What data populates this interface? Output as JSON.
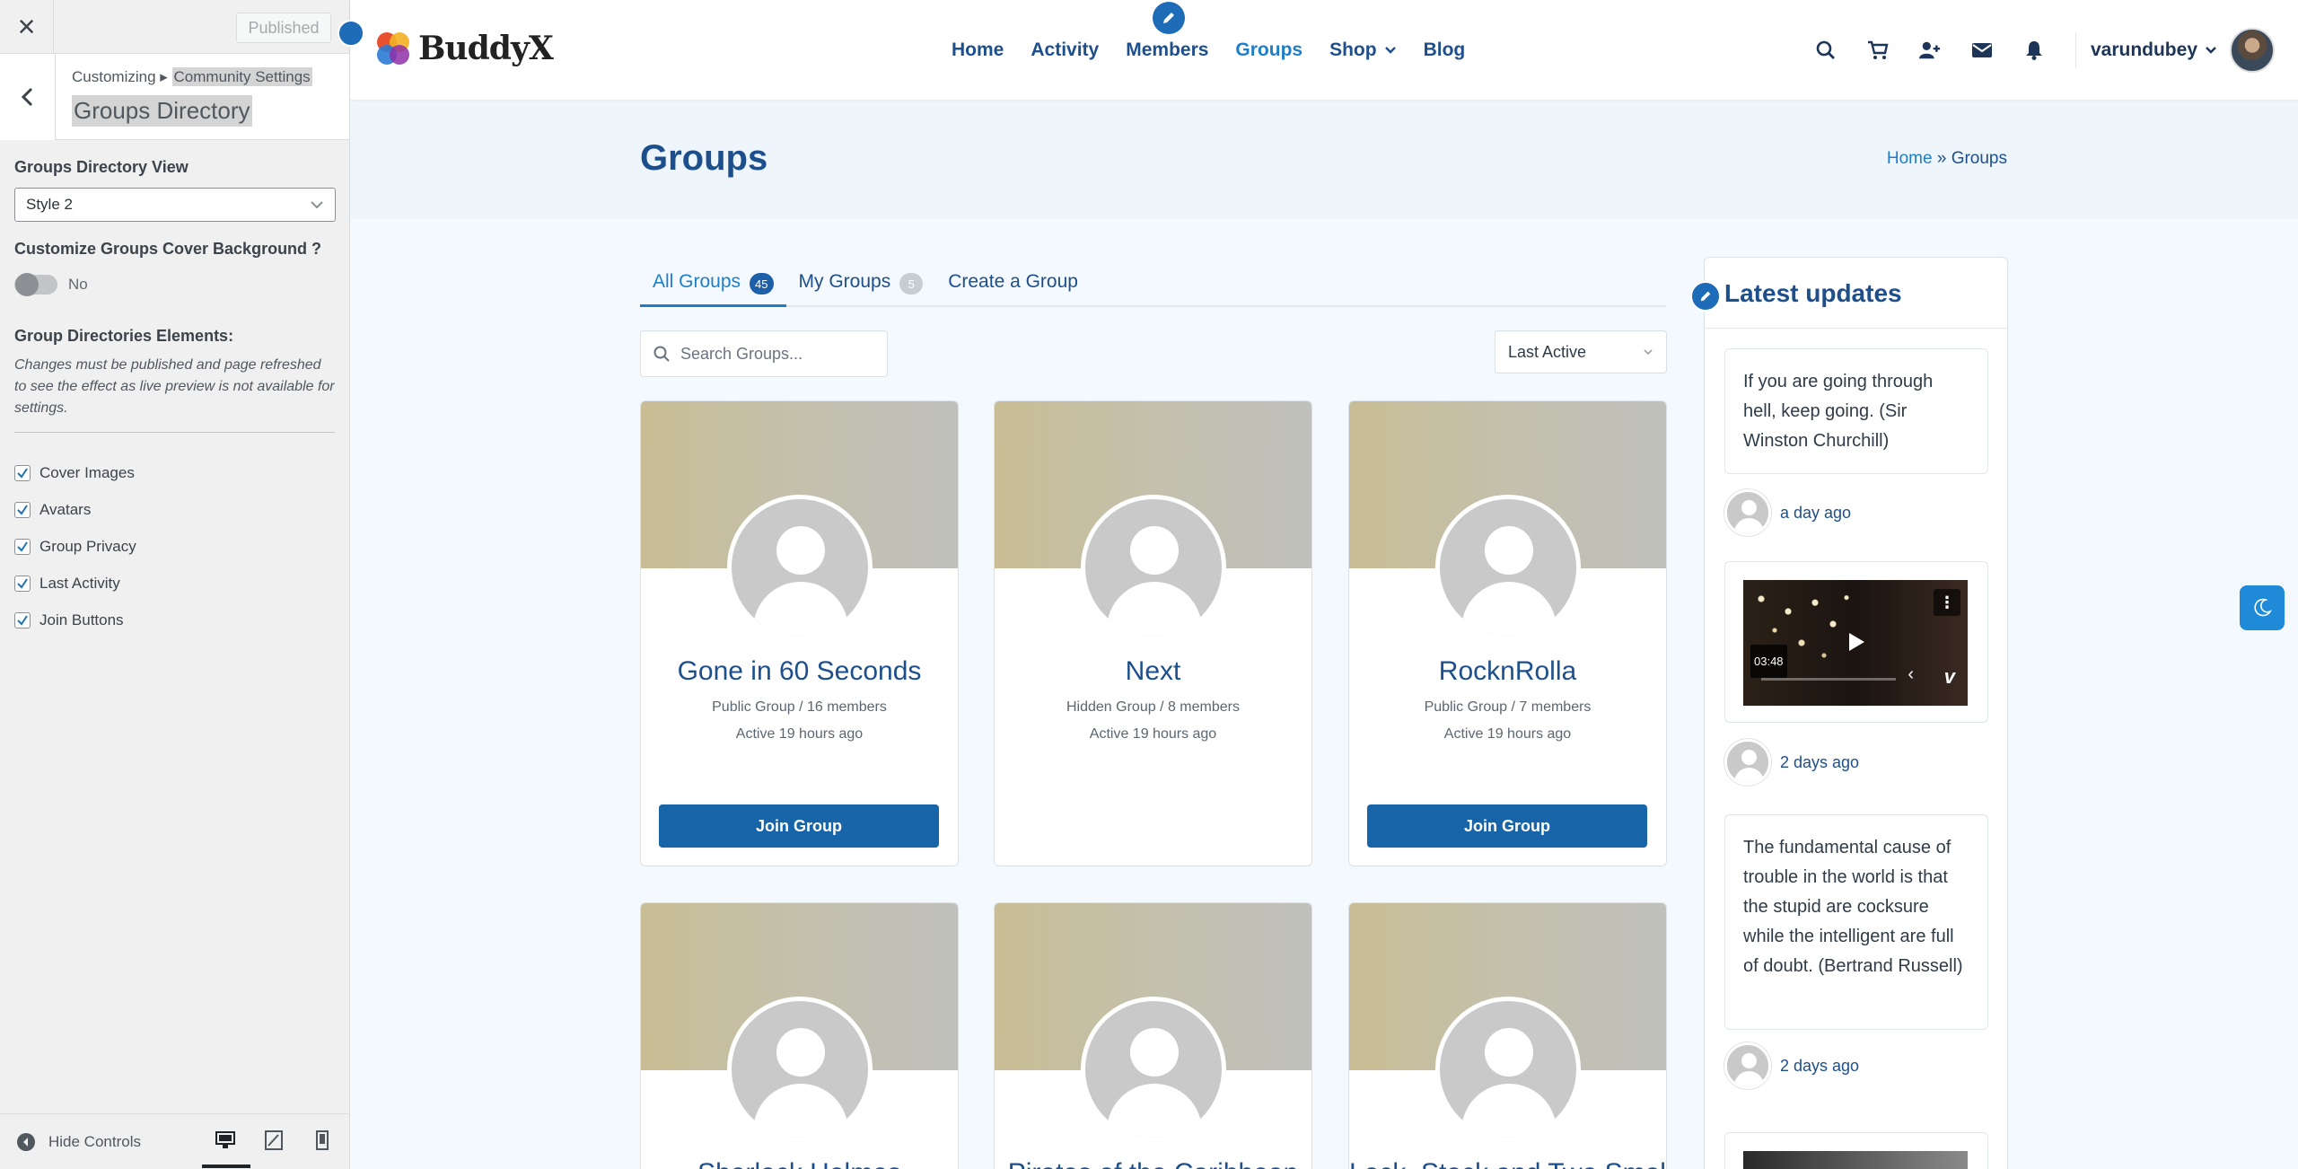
{
  "customizer": {
    "publish_label": "Published",
    "crumb_prefix": "Customizing ▸",
    "crumb_section": "Community Settings",
    "panel_title": "Groups Directory",
    "directory_view_label": "Groups Directory View",
    "directory_view_value": "Style 2",
    "cover_bg_label": "Customize Groups Cover Background ?",
    "cover_bg_value": "No",
    "elements_label": "Group Directories Elements:",
    "elements_note": "Changes must be published and page refreshed to see the effect as live preview is not available for settings.",
    "elements": [
      {
        "label": "Cover Images",
        "checked": true
      },
      {
        "label": "Avatars",
        "checked": true
      },
      {
        "label": "Group Privacy",
        "checked": true
      },
      {
        "label": "Last Activity",
        "checked": true
      },
      {
        "label": "Join Buttons",
        "checked": true
      }
    ],
    "hide_controls_label": "Hide Controls"
  },
  "header": {
    "logo_text": "BuddyX",
    "nav": [
      "Home",
      "Activity",
      "Members",
      "Groups",
      "Shop",
      "Blog"
    ],
    "active_nav": "Groups",
    "username": "varundubey"
  },
  "page": {
    "title": "Groups",
    "breadcrumb_home": "Home",
    "breadcrumb_sep": "»",
    "breadcrumb_current": "Groups"
  },
  "tabs": [
    {
      "label": "All Groups",
      "count": "45"
    },
    {
      "label": "My Groups",
      "count": "5"
    },
    {
      "label": "Create a Group"
    }
  ],
  "search": {
    "placeholder": "Search Groups..."
  },
  "order_by": "Last Active",
  "groups": [
    {
      "name": "Gone in 60 Seconds",
      "meta": "Public Group / 16 members",
      "active": "Active 19 hours ago",
      "button": "Join Group"
    },
    {
      "name": "Next",
      "meta": "Hidden Group / 8 members",
      "active": "Active 19 hours ago",
      "button": ""
    },
    {
      "name": "RocknRolla",
      "meta": "Public Group / 7 members",
      "active": "Active 19 hours ago",
      "button": "Join Group"
    },
    {
      "name": "Sherlock Holmes",
      "meta": "",
      "active": "",
      "button": ""
    },
    {
      "name": "Pirates of the Caribbean",
      "meta": "",
      "active": "",
      "button": ""
    },
    {
      "name": "Lock, Stock and Two Smoking Barrels",
      "meta": "",
      "active": "",
      "button": ""
    }
  ],
  "widget": {
    "title": "Latest updates",
    "updates": [
      {
        "text": "If you are going through hell, keep going. (Sir Winston Churchill)",
        "time": "a day ago"
      },
      {
        "video_duration": "03:48",
        "time": "2 days ago"
      },
      {
        "text": "The fundamental cause of trouble in the world is that the stupid are cocksure while the intelligent are full of doubt. (Bertrand Russell)",
        "time": "2 days ago"
      }
    ]
  },
  "colors": {
    "primary": "#1d4f8c",
    "accent": "#1e7ec8",
    "button": "#1864a8"
  }
}
